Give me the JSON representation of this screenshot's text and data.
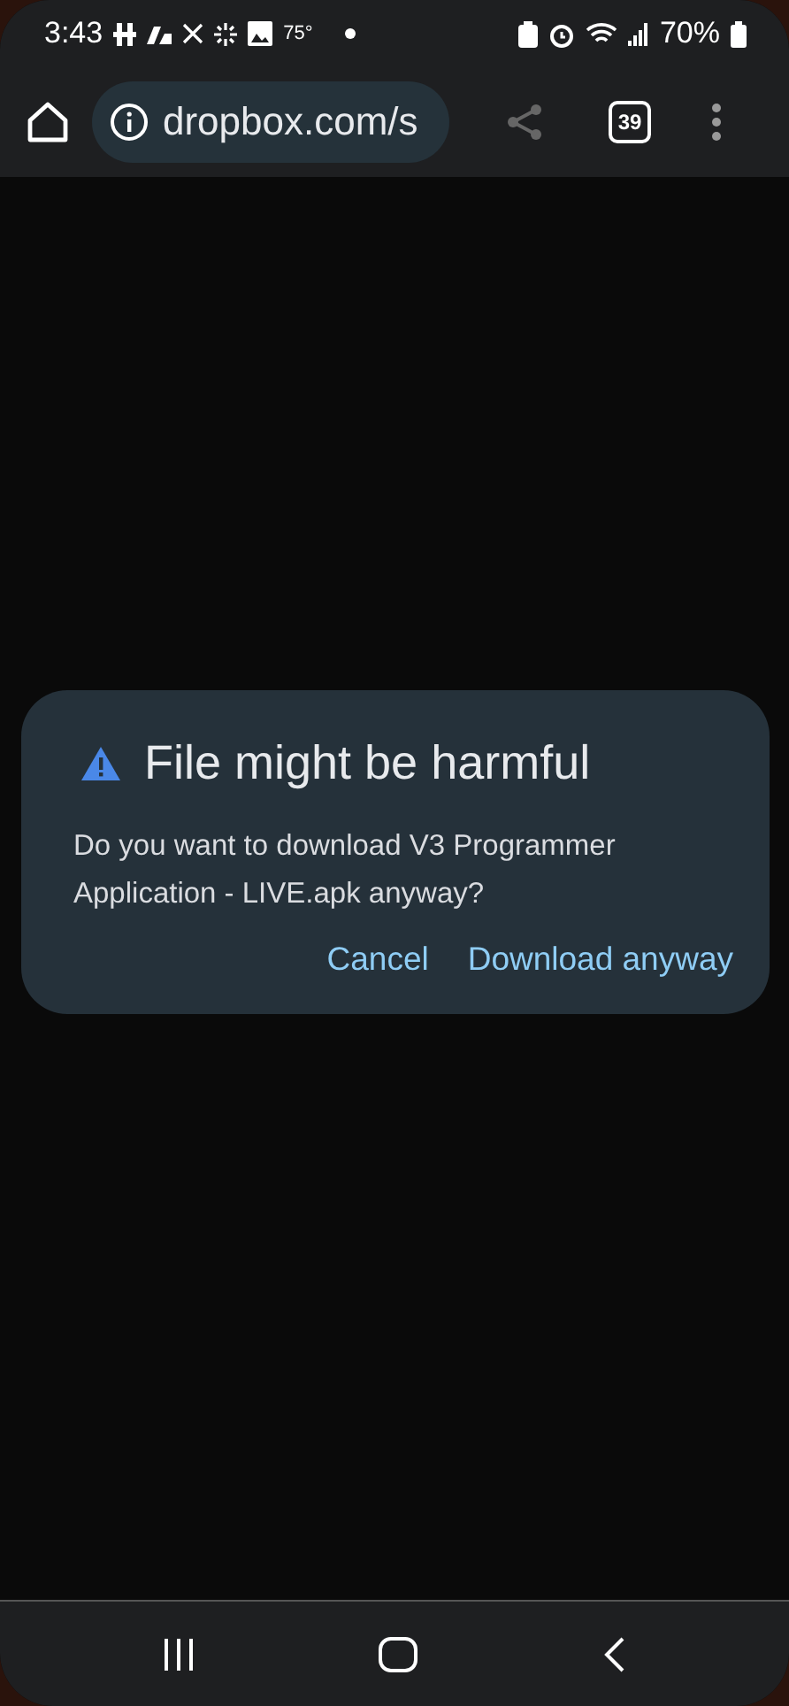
{
  "status_bar": {
    "time": "3:43",
    "temperature": "75°",
    "battery": "70%"
  },
  "toolbar": {
    "url": "dropbox.com/s",
    "tab_count": "39"
  },
  "dialog": {
    "title": "File might be harmful",
    "message": "Do you want to download V3 Programmer Application - LIVE.apk anyway?",
    "buttons": [
      "Cancel",
      "Download anyway"
    ]
  }
}
